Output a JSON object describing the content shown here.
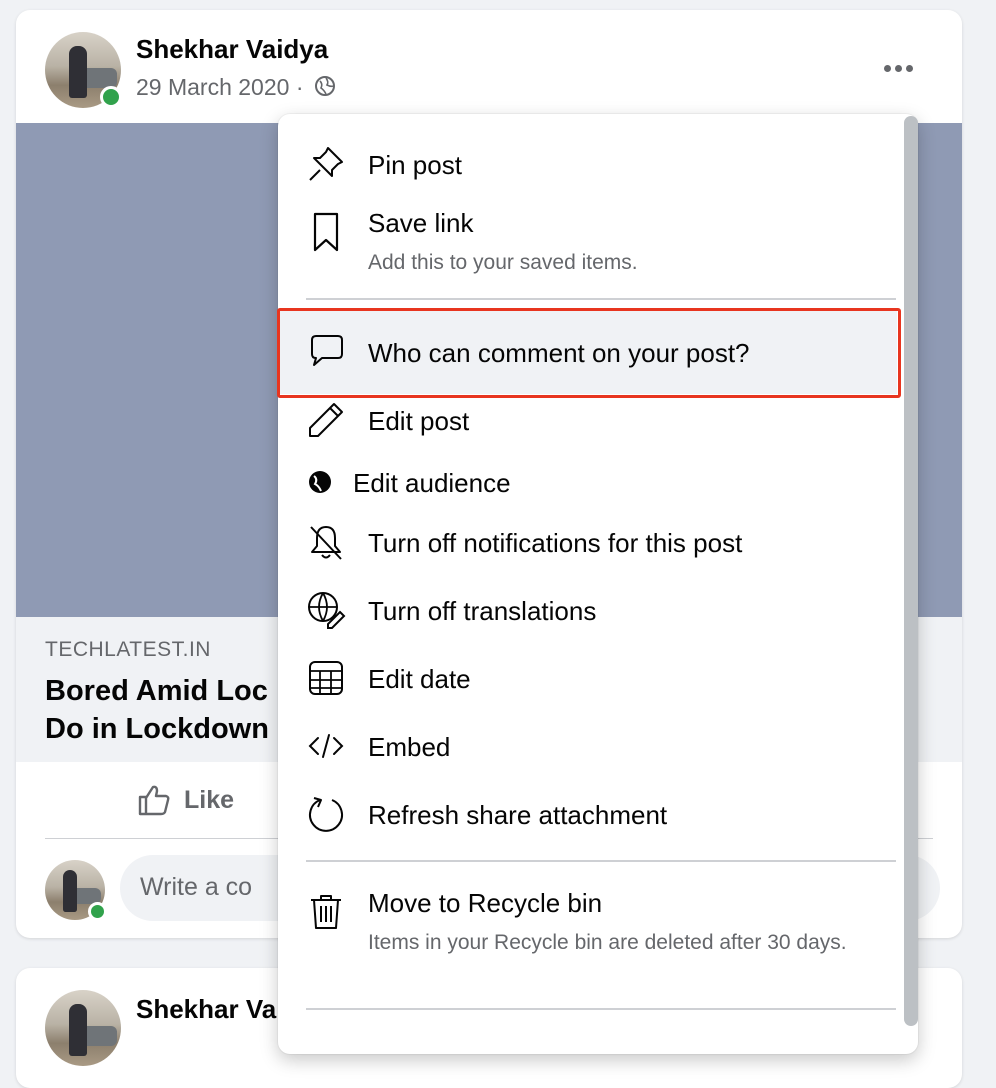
{
  "post": {
    "author": "Shekhar Vaidya",
    "date": "29 March 2020 ·",
    "link_domain": "TECHLATEST.IN",
    "link_title_line1": "Bored Amid Loc",
    "link_title_line2": "Do in Lockdown",
    "like_label": "Like",
    "comment_placeholder": "Write a co"
  },
  "next_post": {
    "author": "Shekhar Va"
  },
  "menu": {
    "items": [
      {
        "label": "Pin post",
        "icon": "pin-icon"
      },
      {
        "label": "Save link",
        "sub": "Add this to your saved items.",
        "icon": "bookmark-icon"
      },
      {
        "label": "Who can comment on your post?",
        "icon": "speech-bubble-icon",
        "highlighted": true
      },
      {
        "label": "Edit post",
        "icon": "pencil-icon"
      },
      {
        "label": "Edit audience",
        "icon": "globe-icon"
      },
      {
        "label": "Turn off notifications for this post",
        "icon": "bell-off-icon"
      },
      {
        "label": "Turn off translations",
        "icon": "globe-translate-icon"
      },
      {
        "label": "Edit date",
        "icon": "calendar-icon"
      },
      {
        "label": "Embed",
        "icon": "code-icon"
      },
      {
        "label": "Refresh share attachment",
        "icon": "refresh-icon"
      },
      {
        "label": "Move to Recycle bin",
        "sub": "Items in your Recycle bin are deleted after 30 days.",
        "icon": "trash-icon"
      }
    ]
  },
  "colors": {
    "highlight_border": "#e8351f",
    "online": "#31a24c",
    "image_bg": "#8f9ab4"
  }
}
